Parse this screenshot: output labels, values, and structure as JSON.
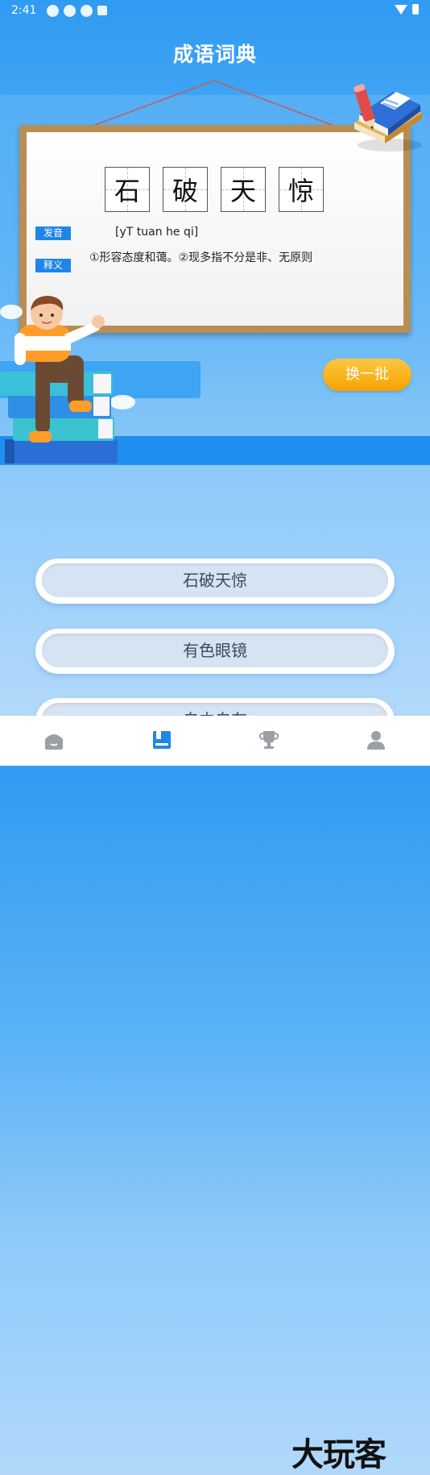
{
  "status_bar": {
    "time": "2:41"
  },
  "header": {
    "title": "成语词典"
  },
  "card": {
    "characters": [
      "石",
      "破",
      "天",
      "惊"
    ],
    "pronunciation_label": "发音",
    "pronunciation": "[yT tuan he qi]",
    "meaning_label": "释义",
    "meaning": "①形容态度和蔼。②现多指不分是非、无原则"
  },
  "actions": {
    "refresh_label": "换一批"
  },
  "options": [
    {
      "label": "石破天惊"
    },
    {
      "label": "有色眼镜"
    },
    {
      "label": "自由自在"
    }
  ],
  "tabbar": {
    "items": [
      {
        "icon": "home-icon"
      },
      {
        "icon": "book-icon",
        "active": true
      },
      {
        "icon": "trophy-icon"
      },
      {
        "icon": "user-icon"
      }
    ]
  },
  "watermark": "大玩客",
  "colors": {
    "accent": "#1f86e8",
    "button": "#f5a300",
    "active_tab": "#1f86e8"
  }
}
